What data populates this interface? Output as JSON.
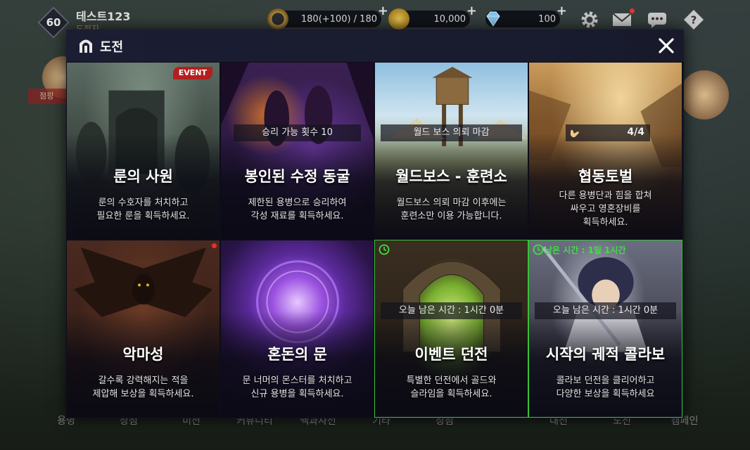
{
  "player": {
    "level": "60",
    "name": "테스트123",
    "sub": "도전자"
  },
  "resources": {
    "stamina": {
      "value": "180(+100) / 180",
      "icon": "horseshoe-icon"
    },
    "gold": {
      "value": "10,000",
      "icon": "gold-coin-icon"
    },
    "gem": {
      "value": "100",
      "icon": "diamond-icon"
    },
    "plus": "+"
  },
  "top_icons": [
    "gear-icon",
    "mail-icon",
    "chat-icon",
    "help-icon"
  ],
  "bottom_nav": [
    "용병",
    "상점",
    "미션",
    "커뮤니티",
    "백과사전",
    "기타",
    "상점",
    "대전",
    "도전",
    "캠페인"
  ],
  "background_banner": "점핑",
  "modal": {
    "title": "도전",
    "title_icon": "gate-icon",
    "close_icon": "close-icon"
  },
  "tiles": [
    {
      "title": "룬의 사원",
      "desc": "룬의 수호자를 처치하고\n필요한 룬을 획득하세요.",
      "badge": "EVENT"
    },
    {
      "title": "봉인된 수정 동굴",
      "desc": "제한된 용병으로 승리하여\n각성 재료를 획득하세요.",
      "tag": "승리 가능 횟수 10"
    },
    {
      "title": "월드보스 - 훈련소",
      "desc": "월드보스 의뢰 마감 이후에는\n훈련소만 이용 가능합니다.",
      "tag": "월드 보스 의뢰 마감"
    },
    {
      "title": "협동토벌",
      "desc": "다른 용병단과 힘을 합쳐\n싸우고 영혼장비를\n획득하세요.",
      "counter": "4/4"
    },
    {
      "title": "악마성",
      "desc": "갈수록 강력해지는 적을\n제압해 보상을 획득하세요."
    },
    {
      "title": "혼돈의 문",
      "desc": "문 너머의 몬스터를 처치하고\n신규 용병을 획득하세요."
    },
    {
      "title": "이벤트 던전",
      "desc": "특별한 던전에서 골드와\n슬라임을 획득하세요.",
      "tag": "오늘 남은 시간 : 1시간 0분"
    },
    {
      "title": "시작의 궤적 콜라보",
      "desc": "콜라보 던전을 클리어하고\n다양한 보상을 획득하세요",
      "tag": "오늘 남은 시간 : 1시간 0분",
      "remain_top": "남은 시간 : 1일 1시간"
    }
  ],
  "colors": {
    "active_border": "#38c23a",
    "event_badge": "#b31f1f",
    "notice_dot": "#e52f2f",
    "modal_bg": "#111322"
  }
}
